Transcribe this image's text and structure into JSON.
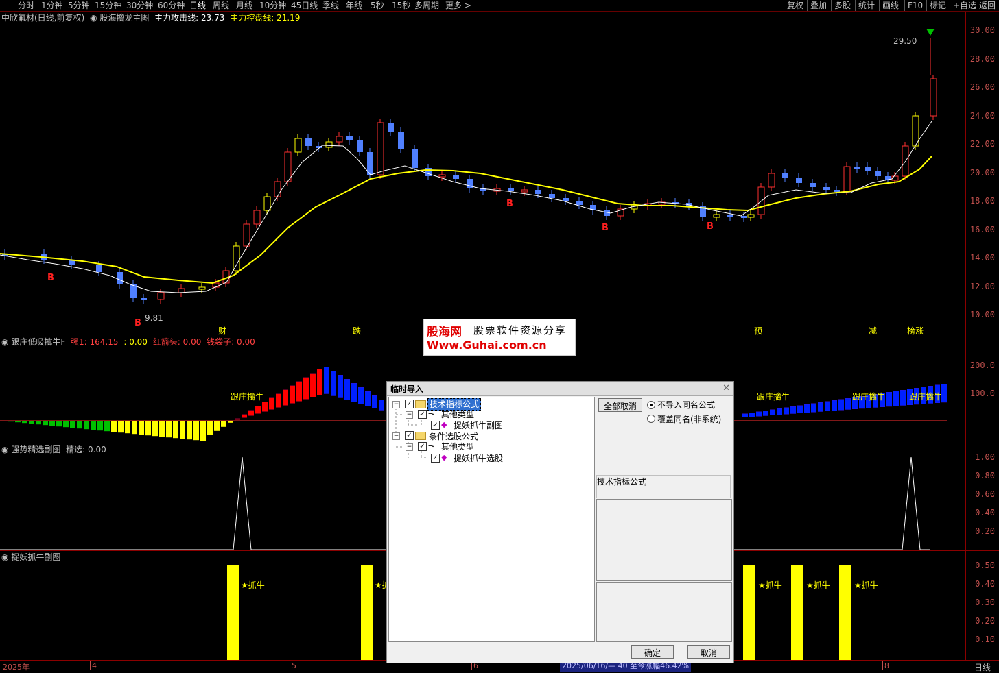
{
  "toolbar": {
    "periods": [
      "分时",
      "1分钟",
      "5分钟",
      "15分钟",
      "30分钟",
      "60分钟",
      "日线",
      "周线",
      "月线",
      "10分钟",
      "45日线",
      "季线",
      "年线",
      "5秒",
      "15秒",
      "多周期",
      "更多 >"
    ],
    "active_period": "日线",
    "right_buttons": [
      "复权",
      "叠加",
      "多股",
      "统计",
      "画线",
      "F10",
      "标记",
      "+自选",
      "返回"
    ]
  },
  "main_panel": {
    "stock_name": "中欣氟材(日线,前复权)",
    "indicator_name": "股海擒龙主图",
    "line1_label": "主力攻击线: 23.73",
    "line2_label": "主力控盘线: 21.19",
    "price_axis": [
      "30.00",
      "28.00",
      "26.00",
      "24.00",
      "22.00",
      "20.00",
      "18.00",
      "16.00",
      "14.00",
      "12.00",
      "10.00"
    ],
    "high_marker": "29.50",
    "low_marker": "9.81",
    "bottom_labels": [
      "财",
      "跌",
      "预",
      "减",
      "榜涨"
    ],
    "b_markers": [
      "B",
      "B",
      "B",
      "B",
      "B"
    ]
  },
  "sub1_panel": {
    "name": "跟庄低吸擒牛F",
    "values": [
      {
        "text": "强1: 164.15",
        "color": "#ff4040"
      },
      {
        "text": ": 0.00",
        "color": "#ffff00"
      },
      {
        "text": "红箭头: 0.00",
        "color": "#ff4040"
      },
      {
        "text": "钱袋子: 0.00",
        "color": "#ff4040"
      }
    ],
    "axis": [
      "200.0",
      "100.0"
    ],
    "tag_labels": [
      "跟庄擒牛",
      "跟庄擒牛",
      "跟庄擒牛",
      "跟庄擒牛"
    ]
  },
  "sub2_panel": {
    "name": "强势精选副图",
    "value": "精选: 0.00",
    "axis": [
      "1.00",
      "0.80",
      "0.60",
      "0.40",
      "0.20"
    ]
  },
  "sub3_panel": {
    "name": "捉妖抓牛副图",
    "axis": [
      "0.50",
      "0.40",
      "0.30",
      "0.20",
      "0.10"
    ],
    "tag_labels": [
      "★抓牛",
      "★抓",
      "★抓牛",
      "★抓牛",
      "★抓牛"
    ]
  },
  "status": {
    "dates": [
      "2025年",
      "4",
      "5",
      "6",
      "8"
    ],
    "range_text": "2025/06/16/— 40 至今涨幅46.42%",
    "period": "日线"
  },
  "watermark": {
    "logo": "股海网",
    "slogan": "股票软件资源分享",
    "url": "Www.Guhai.com.cn"
  },
  "dialog": {
    "title": "临时导入",
    "tree": [
      {
        "label": "技术指标公式",
        "selected": true
      },
      {
        "label": "其他类型"
      },
      {
        "label": "捉妖抓牛副图"
      },
      {
        "label": "条件选股公式"
      },
      {
        "label": "其他类型"
      },
      {
        "label": "捉妖抓牛选股"
      }
    ],
    "cancel_all_button": "全部取消",
    "radio_options": [
      "不导入同名公式",
      "覆盖同名(非系统)"
    ],
    "selected_radio": 0,
    "info_label": "技术指标公式",
    "ok_button": "确定",
    "cancel_button": "取消"
  },
  "colors": {
    "up": "#ff3030",
    "down": "#5080ff",
    "yellow": "#ffff00",
    "grid": "#8b0000",
    "axis_text": "#c0504d"
  }
}
